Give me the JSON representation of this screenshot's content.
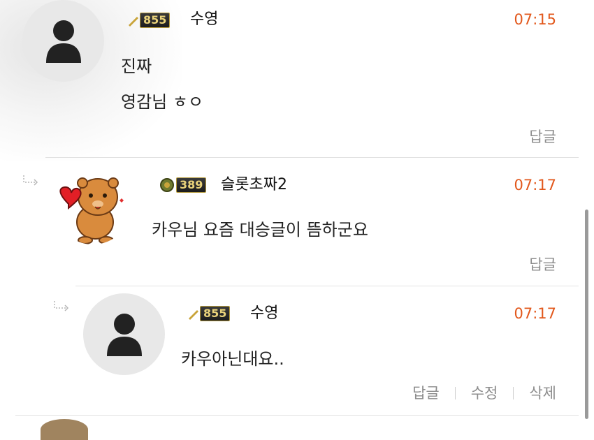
{
  "comments": [
    {
      "level": "855",
      "nickname": "수영",
      "time": "07:15",
      "lines": [
        "진짜",
        "영감님 ㅎㅇ"
      ],
      "actions": [
        "답글"
      ],
      "avatar": "default-user-icon"
    },
    {
      "level": "389",
      "nickname": "슬롯초짜2",
      "time": "07:17",
      "lines": [
        "카우님 요즘 대승글이 뜸하군요"
      ],
      "actions": [
        "답글"
      ],
      "avatar": "bear-heart-sticker-icon"
    },
    {
      "level": "855",
      "nickname": "수영",
      "time": "07:17",
      "lines": [
        "카우아닌대요.."
      ],
      "actions": [
        "답글",
        "수정",
        "삭제"
      ],
      "avatar": "default-user-icon"
    }
  ],
  "colors": {
    "time": "#e2581c",
    "action": "#8c8c8c",
    "avatar_bg": "#e8e8e8"
  }
}
